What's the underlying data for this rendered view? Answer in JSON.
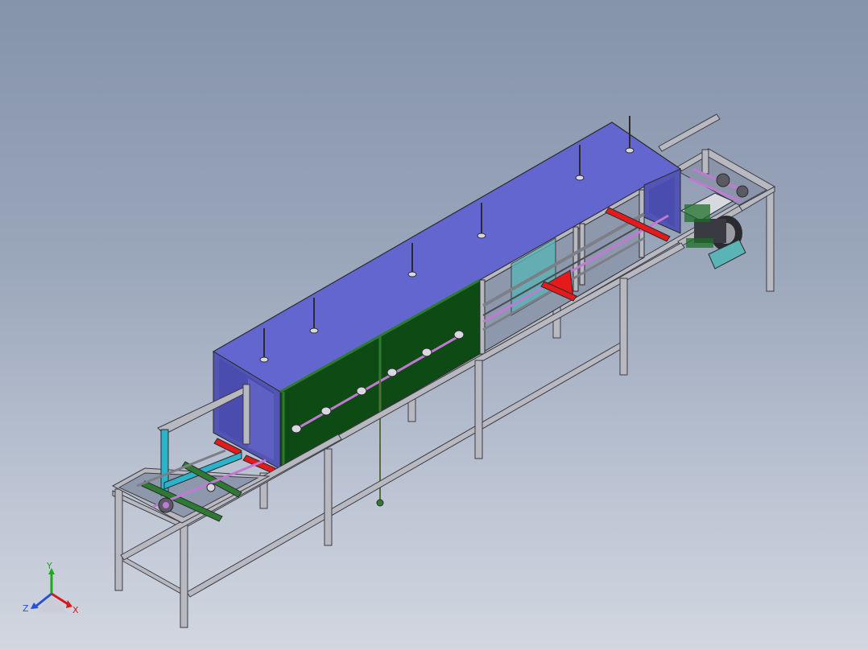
{
  "viewport": {
    "background_top": "#8593ab",
    "background_bottom": "#d2d7e0"
  },
  "model": {
    "colors": {
      "frame": "#b8b9c0",
      "frame_edge": "#3b3c44",
      "cover_top": "#6466cf",
      "cover_side": "#5355b4",
      "panel_green": "#0e4a14",
      "panel_green_light": "#2f7a33",
      "rail_pink": "#c07ad3",
      "rail_grey": "#7d7f88",
      "red_bracket": "#e61a1a",
      "cyan_bar": "#2bb3c9",
      "teal_plate": "#5ab3b5",
      "motor": "#2a2b30"
    }
  },
  "triad": {
    "x_label": "X",
    "y_label": "Y",
    "z_label": "Z",
    "x_color": "#d21c1c",
    "y_color": "#1fa81f",
    "z_color": "#2a4fd6"
  }
}
